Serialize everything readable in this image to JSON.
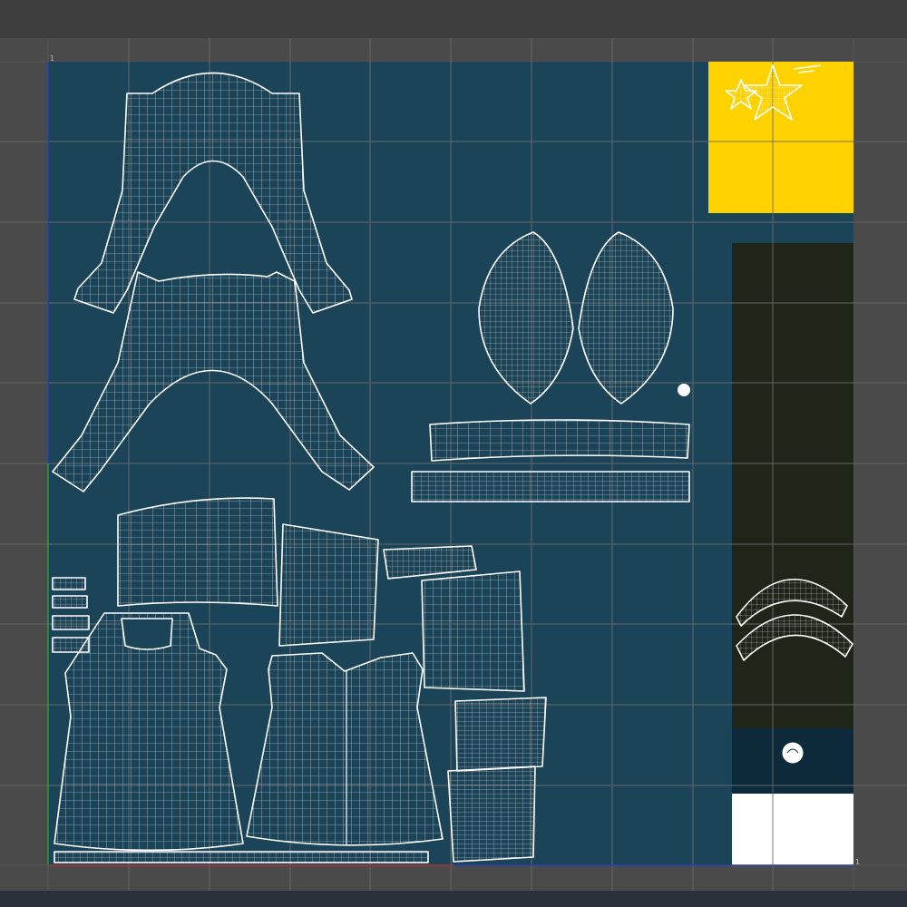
{
  "editor": {
    "uv_tile_label_top_left": "1",
    "uv_tile_label_bottom_right": "1"
  },
  "colors": {
    "background": "#4a4a4a",
    "top_bar": "#3e3e3e",
    "bottom_bar": "#2a3138",
    "uv_tile": "#1c4459",
    "grid_line": "#6b6b6b",
    "wire": "#ffffff",
    "yellow_swatch": "#ffd200",
    "dark_olive_swatch": "#20251a",
    "dark_teal_swatch": "#0d2a3a",
    "white_swatch": "#ffffff",
    "axis_u": "#b03030",
    "axis_v": "#2f9a3a"
  },
  "uv_islands": [
    "top-garment-upper",
    "top-garment-lower",
    "cup-left",
    "cup-right",
    "band-upper",
    "band-lower",
    "skirt-panel-left",
    "skirt-panel-right",
    "small-rect-panel",
    "strap-piece",
    "square-patch",
    "dress-front",
    "dress-back",
    "sleeve-stack-upper",
    "sleeve-stack-lower",
    "small-tab-1",
    "small-tab-2",
    "small-tab-3",
    "small-tab-4",
    "bottom-trim-strip",
    "headband-upper",
    "headband-lower",
    "star-decal",
    "button-dot",
    "button-disc"
  ]
}
